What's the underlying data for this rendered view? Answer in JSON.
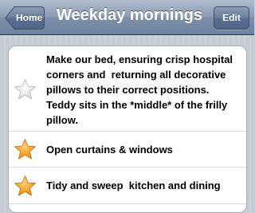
{
  "navbar": {
    "back_label": "Home",
    "title": "Weekday mornings",
    "edit_label": "Edit"
  },
  "tasks": [
    {
      "text": "Make our bed, ensuring crisp hospital corners and  returning all decorative pillows to their correct positions. Teddy sits in the *middle* of the frilly pillow.",
      "star_color": "#e6e6e6",
      "starred": false
    },
    {
      "text": "Open curtains & windows",
      "star_color": "#f59a1d",
      "starred": true
    },
    {
      "text": "Tidy and sweep  kitchen and dining",
      "star_color": "#f59a1d",
      "starred": true
    }
  ]
}
